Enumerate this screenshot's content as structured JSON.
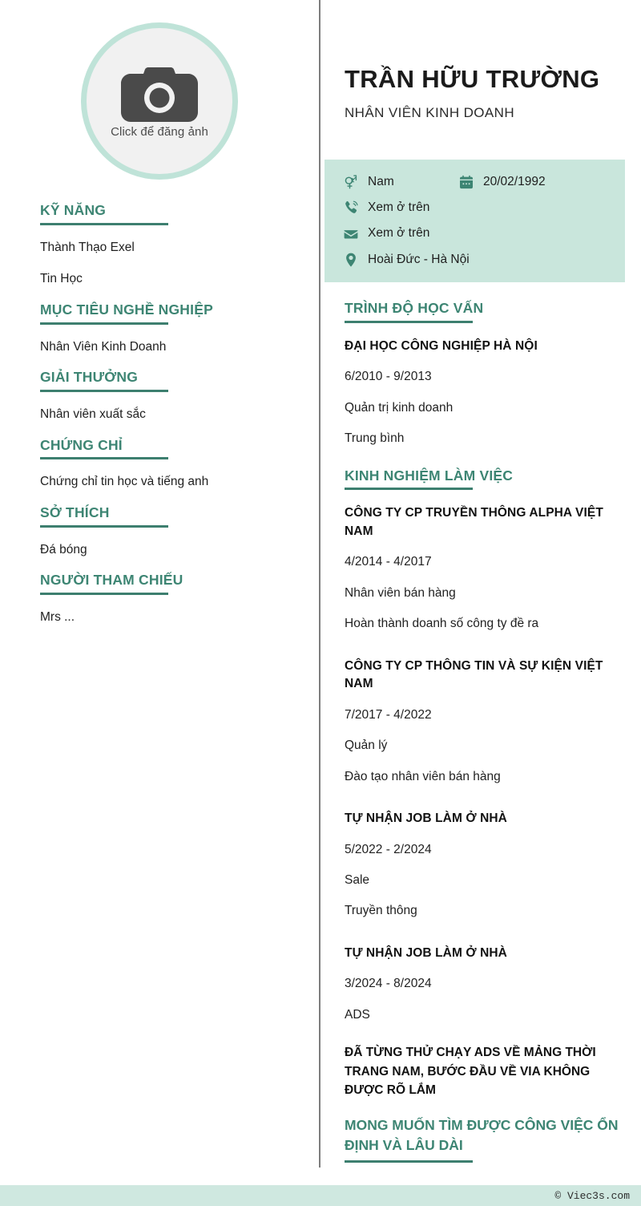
{
  "photo": {
    "caption": "Click để đăng ảnh",
    "icon": "camera-icon"
  },
  "header": {
    "name": "TRẦN HỮU TRƯỜNG",
    "title": "NHÂN VIÊN KINH DOANH"
  },
  "contact": {
    "gender": {
      "icon": "venus-mars-icon",
      "value": "Nam"
    },
    "birthdate": {
      "icon": "calendar-icon",
      "value": "20/02/1992"
    },
    "phone": {
      "icon": "phone-icon",
      "value": "Xem ở trên"
    },
    "email": {
      "icon": "envelope-icon",
      "value": "Xem ở trên"
    },
    "address": {
      "icon": "location-pin-icon",
      "value": "Hoài Đức - Hà Nội"
    }
  },
  "sidebar": {
    "sections": [
      {
        "heading": "KỸ NĂNG",
        "items": [
          "Thành Thạo Exel",
          "Tin Học"
        ]
      },
      {
        "heading": "MỤC TIÊU NGHỀ NGHIỆP",
        "items": [
          "Nhân Viên Kinh Doanh"
        ]
      },
      {
        "heading": "GIẢI THƯỞNG",
        "items": [
          "Nhân viên xuất sắc"
        ]
      },
      {
        "heading": "CHỨNG CHỈ",
        "items": [
          "Chứng chỉ tin học và tiếng anh"
        ]
      },
      {
        "heading": "SỞ THÍCH",
        "items": [
          "Đá bóng"
        ]
      },
      {
        "heading": "NGƯỜI THAM CHIẾU",
        "items": [
          "Mrs ..."
        ]
      }
    ]
  },
  "education": {
    "heading": "TRÌNH ĐỘ HỌC VẤN",
    "entries": [
      {
        "school": "ĐẠI HỌC CÔNG NGHIỆP HÀ NỘI",
        "period": "6/2010 - 9/2013",
        "major": "Quản trị kinh doanh",
        "grade": "Trung bình"
      }
    ]
  },
  "experience": {
    "heading": "KINH NGHIỆM LÀM VIỆC",
    "entries": [
      {
        "company": "CÔNG TY CP TRUYỀN THÔNG ALPHA VIỆT NAM",
        "period": "4/2014 - 4/2017",
        "role": "Nhân viên bán hàng",
        "detail": "Hoàn thành doanh số công ty đề ra"
      },
      {
        "company": "CÔNG TY CP THÔNG TIN VÀ SỰ KIỆN VIỆT NAM",
        "period": "7/2017 - 4/2022",
        "role": "Quản lý",
        "detail": "Đào tạo nhân viên bán hàng"
      },
      {
        "company": "TỰ NHẬN JOB LÀM Ở NHÀ",
        "period": "5/2022 - 2/2024",
        "role": "Sale",
        "detail": "Truyền thông"
      },
      {
        "company": "TỰ NHẬN JOB LÀM Ở NHÀ",
        "period": "3/2024 - 8/2024",
        "role": "ADS",
        "detail": ""
      }
    ],
    "closing_note": "ĐÃ TỪNG THỬ CHẠY ADS VỀ MẢNG THỜI TRANG NAM, BƯỚC ĐẦU VỀ VIA KHÔNG ĐƯỢC RÕ LẮM",
    "closing_green": "MONG MUỐN TÌM ĐƯỢC CÔNG VIỆC ỔN ĐỊNH VÀ LÂU DÀI"
  },
  "footer": {
    "copyright": "© Viec3s.com"
  },
  "colors": {
    "accent": "#3d8573",
    "rule": "#3d7f6f",
    "contact_bg": "#c9e6dc",
    "footer_bg": "#cfe8e0",
    "photo_ring": "#bfe3d8",
    "photo_fill": "#f1f1f1",
    "divider": "#7d7d7d"
  }
}
